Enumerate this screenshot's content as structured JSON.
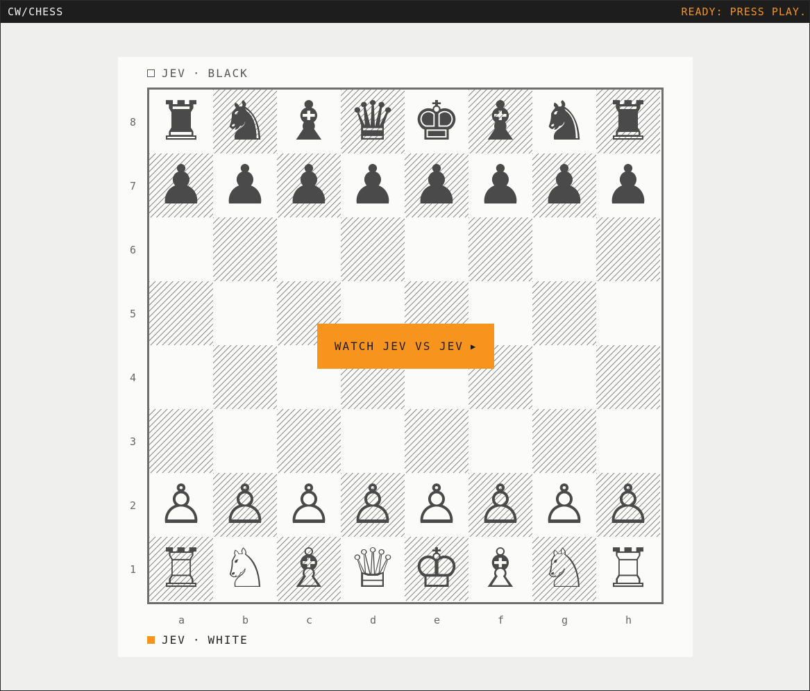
{
  "app": {
    "title": "CW/CHESS",
    "status": "READY: PRESS PLAY."
  },
  "players": {
    "top": {
      "name": "JEV",
      "separator": "·",
      "side": "BLACK"
    },
    "bottom": {
      "name": "JEV",
      "separator": "·",
      "side": "WHITE"
    }
  },
  "colors": {
    "accent": "#f7941d",
    "titlebar": "#1d1d1d"
  },
  "board": {
    "files": [
      "a",
      "b",
      "c",
      "d",
      "e",
      "f",
      "g",
      "h"
    ],
    "ranks": [
      "8",
      "7",
      "6",
      "5",
      "4",
      "3",
      "2",
      "1"
    ],
    "position": [
      [
        "br",
        "bn",
        "bb",
        "bq",
        "bk",
        "bb",
        "bn",
        "br"
      ],
      [
        "bp",
        "bp",
        "bp",
        "bp",
        "bp",
        "bp",
        "bp",
        "bp"
      ],
      [
        "",
        "",
        "",
        "",
        "",
        "",
        "",
        ""
      ],
      [
        "",
        "",
        "",
        "",
        "",
        "",
        "",
        ""
      ],
      [
        "",
        "",
        "",
        "",
        "",
        "",
        "",
        ""
      ],
      [
        "",
        "",
        "",
        "",
        "",
        "",
        "",
        ""
      ],
      [
        "wp",
        "wp",
        "wp",
        "wp",
        "wp",
        "wp",
        "wp",
        "wp"
      ],
      [
        "wr",
        "wn",
        "wb",
        "wq",
        "wk",
        "wb",
        "wn",
        "wr"
      ]
    ]
  },
  "play_button": {
    "label": "WATCH JEV VS JEV",
    "icon": "play-icon"
  }
}
